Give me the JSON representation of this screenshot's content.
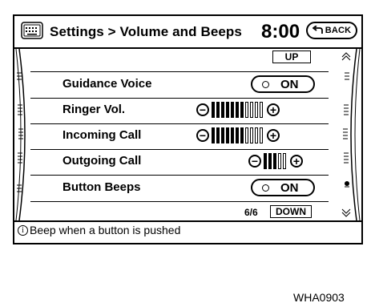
{
  "header": {
    "menu_icon": "keypad-icon",
    "title": "Settings > Volume and Beeps",
    "time": "8:00",
    "back_label": "BACK",
    "back_icon": "return-arrow-icon"
  },
  "scroll": {
    "up_label": "UP",
    "down_label": "DOWN",
    "page_indicator": "6/6"
  },
  "items": [
    {
      "label": "Guidance Voice",
      "type": "toggle",
      "value": "ON"
    },
    {
      "label": "Ringer Vol.",
      "type": "slider",
      "level": 7,
      "max": 11
    },
    {
      "label": "Incoming Call",
      "type": "slider",
      "level": 7,
      "max": 11
    },
    {
      "label": "Outgoing Call",
      "type": "slider",
      "level": 3,
      "max": 5
    },
    {
      "label": "Button Beeps",
      "type": "toggle",
      "value": "ON"
    }
  ],
  "info": {
    "icon": "info-icon",
    "text": "Beep when a button is pushed"
  },
  "figure_code": "WHA0903"
}
